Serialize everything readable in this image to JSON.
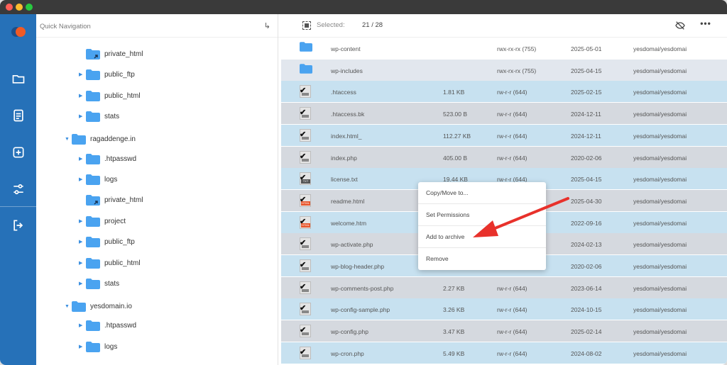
{
  "window": {
    "traffic_lights": [
      "close",
      "minimize",
      "maximize"
    ]
  },
  "sidebar": {
    "icons": [
      "logo-icon",
      "folder-icon",
      "document-icon",
      "add-icon",
      "settings-sliders-icon",
      "logout-icon"
    ]
  },
  "tree": {
    "title": "Quick Navigation",
    "collapse_icon": "↳",
    "items": [
      {
        "label": "private_html",
        "expandable": false,
        "link": true
      },
      {
        "label": "public_ftp",
        "expandable": true,
        "link": false
      },
      {
        "label": "public_html",
        "expandable": true,
        "link": false
      },
      {
        "label": "stats",
        "expandable": true,
        "link": false
      },
      {
        "label": "ragaddenge.in",
        "expandable": true,
        "expanded": true,
        "link": false
      },
      {
        "label": ".htpasswd",
        "expandable": true,
        "link": false
      },
      {
        "label": "logs",
        "expandable": true,
        "link": false
      },
      {
        "label": "private_html",
        "expandable": false,
        "link": true
      },
      {
        "label": "project",
        "expandable": true,
        "link": false
      },
      {
        "label": "public_ftp",
        "expandable": true,
        "link": false
      },
      {
        "label": "public_html",
        "expandable": true,
        "link": false
      },
      {
        "label": "stats",
        "expandable": true,
        "link": false
      },
      {
        "label": "yesdomain.io",
        "expandable": true,
        "expanded": true,
        "link": false
      },
      {
        "label": ".htpasswd",
        "expandable": true,
        "link": false
      },
      {
        "label": "logs",
        "expandable": true,
        "link": false
      }
    ]
  },
  "toolbar": {
    "selected_label": "Selected:",
    "selected_count": "21 / 28",
    "icons": [
      "hide-icon",
      "more-icon"
    ]
  },
  "files": [
    {
      "name": "wp-content",
      "size": "",
      "perm": "rwx-rx-rx (755)",
      "date": "2025-05-01",
      "owner": "yesdomai/yesdomai",
      "type": "folder",
      "selected": false
    },
    {
      "name": "wp-includes",
      "size": "",
      "perm": "rwx-rx-rx (755)",
      "date": "2025-04-15",
      "owner": "yesdomai/yesdomai",
      "type": "folder",
      "selected": false
    },
    {
      "name": ".htaccess",
      "size": "1.81 KB",
      "perm": "rw-r-r (644)",
      "date": "2025-02-15",
      "owner": "yesdomai/yesdomai",
      "type": "file",
      "selected": true
    },
    {
      "name": ".htaccess.bk",
      "size": "523.00 B",
      "perm": "rw-r-r (644)",
      "date": "2024-12-11",
      "owner": "yesdomai/yesdomai",
      "type": "file",
      "selected": true
    },
    {
      "name": "index.html_",
      "size": "112.27 KB",
      "perm": "rw-r-r (644)",
      "date": "2024-12-11",
      "owner": "yesdomai/yesdomai",
      "type": "file",
      "selected": true
    },
    {
      "name": "index.php",
      "size": "405.00 B",
      "perm": "rw-r-r (644)",
      "date": "2020-02-06",
      "owner": "yesdomai/yesdomai",
      "type": "file",
      "selected": true
    },
    {
      "name": "license.txt",
      "size": "19.44 KB",
      "perm": "rw-r-r (644)",
      "date": "2025-04-15",
      "owner": "yesdomai/yesdomai",
      "type": "txt",
      "selected": true
    },
    {
      "name": "readme.html",
      "size": "",
      "perm": "",
      "date": "2025-04-30",
      "owner": "yesdomai/yesdomai",
      "type": "html",
      "selected": true
    },
    {
      "name": "welcome.htm",
      "size": "",
      "perm": "",
      "date": "2022-09-16",
      "owner": "yesdomai/yesdomai",
      "type": "html",
      "selected": true
    },
    {
      "name": "wp-activate.php",
      "size": "",
      "perm": "",
      "date": "2024-02-13",
      "owner": "yesdomai/yesdomai",
      "type": "file",
      "selected": true
    },
    {
      "name": "wp-blog-header.php",
      "size": "",
      "perm": "",
      "date": "2020-02-06",
      "owner": "yesdomai/yesdomai",
      "type": "file",
      "selected": true
    },
    {
      "name": "wp-comments-post.php",
      "size": "2.27 KB",
      "perm": "rw-r-r (644)",
      "date": "2023-06-14",
      "owner": "yesdomai/yesdomai",
      "type": "file",
      "selected": true
    },
    {
      "name": "wp-config-sample.php",
      "size": "3.26 KB",
      "perm": "rw-r-r (644)",
      "date": "2024-10-15",
      "owner": "yesdomai/yesdomai",
      "type": "file",
      "selected": true
    },
    {
      "name": "wp-config.php",
      "size": "3.47 KB",
      "perm": "rw-r-r (644)",
      "date": "2025-02-14",
      "owner": "yesdomai/yesdomai",
      "type": "file",
      "selected": true
    },
    {
      "name": "wp-cron.php",
      "size": "5.49 KB",
      "perm": "rw-r-r (644)",
      "date": "2024-08-02",
      "owner": "yesdomai/yesdomai",
      "type": "file",
      "selected": true
    }
  ],
  "context_menu": {
    "items": [
      "Copy/Move to...",
      "Set Permissions",
      "Add to archive",
      "Remove"
    ]
  },
  "colors": {
    "sidebar": "#2671b8",
    "folder": "#4aa3f0",
    "row_selected_a": "#c7e1f0",
    "row_selected_b": "#d5d9df",
    "row_plain_a": "#ffffff",
    "row_plain_b": "#e2e7ee",
    "arrow": "#e8312b"
  }
}
